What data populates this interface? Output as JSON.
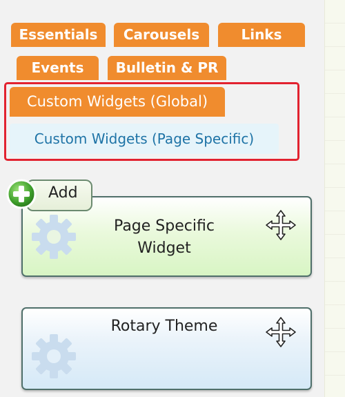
{
  "tabs": {
    "essentials": "Essentials",
    "carousels": "Carousels",
    "links": "Links",
    "events": "Events",
    "bulletin": "Bulletin & PR",
    "custom_global": "Custom Widgets (Global)",
    "custom_page": "Custom Widgets (Page Specific)"
  },
  "add_button": {
    "label": "Add"
  },
  "widgets": [
    {
      "title_line1": "Page Specific",
      "title_line2": "Widget",
      "icon": "gear-icon",
      "move_icon": "move-icon"
    },
    {
      "title_line1": "Rotary Theme",
      "title_line2": "",
      "icon": "gear-icon",
      "move_icon": "move-icon"
    }
  ],
  "colors": {
    "tab_orange": "#f08c2e",
    "selected_tab_text": "#1e73a6",
    "highlight_border": "#e2222f"
  }
}
